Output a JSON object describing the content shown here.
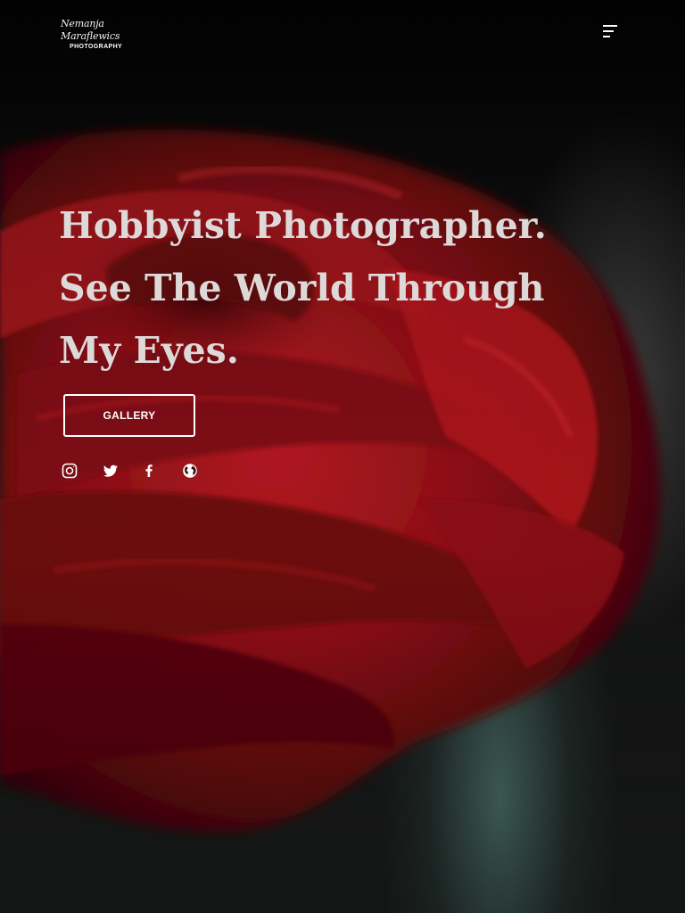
{
  "header": {
    "logo_script": "Nemanja Maraflewics",
    "logo_subtitle": "PHOTOGRAPHY",
    "menu_icon": "hamburger-menu-icon"
  },
  "hero": {
    "headline_lines": [
      "Hobbyist Photographer.",
      "See The World Through",
      "My Eyes."
    ],
    "cta_label": "GALLERY",
    "background_image": "red-rose-photo"
  },
  "social": [
    {
      "name": "instagram",
      "icon": "instagram-icon"
    },
    {
      "name": "twitter",
      "icon": "twitter-icon"
    },
    {
      "name": "facebook",
      "icon": "facebook-icon"
    },
    {
      "name": "website",
      "icon": "globe-icon"
    }
  ],
  "colors": {
    "headline": "#ded9d9",
    "rose": "#8f0f14",
    "background": "#0a0a0a",
    "button_border": "#ffffff"
  }
}
